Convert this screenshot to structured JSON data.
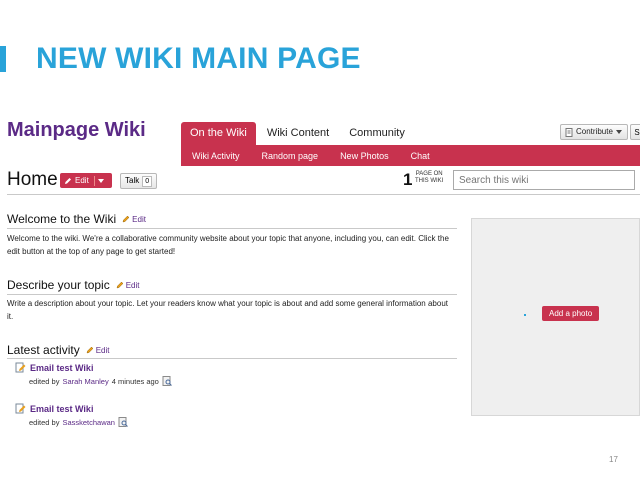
{
  "slide": {
    "title": "NEW WIKI MAIN PAGE",
    "number": "17",
    "accent_color": "#29a3d9"
  },
  "wiki": {
    "name": "Mainpage Wiki",
    "brand_color": "#5b2a86",
    "nav_color": "#c8324e",
    "tabs": [
      {
        "label": "On the Wiki",
        "active": true
      },
      {
        "label": "Wiki Content",
        "active": false
      },
      {
        "label": "Community",
        "active": false
      }
    ],
    "subnav": [
      "Wiki Activity",
      "Random page",
      "New Photos",
      "Chat"
    ],
    "contribute_label": "Contribute",
    "extra_button_label": "S",
    "page_title": "Home",
    "edit_label": "Edit",
    "talk_label": "Talk",
    "talk_count": "0",
    "page_count": "1",
    "page_count_label_line1": "PAGE ON",
    "page_count_label_line2": "THIS WIKI",
    "search_placeholder": "Search this wiki",
    "sections": {
      "welcome": {
        "heading": "Welcome to the Wiki",
        "edit": "Edit",
        "text": "Welcome to the wiki. We're a collaborative community website about your topic that anyone, including you, can edit. Click the edit button at the top of any page to get started!"
      },
      "describe": {
        "heading": "Describe your topic",
        "edit": "Edit",
        "text": "Write a description about your topic. Let your readers know what your topic is about and add some general information about it."
      },
      "activity": {
        "heading": "Latest activity",
        "edit": "Edit",
        "items": [
          {
            "title": "Email test Wiki",
            "prefix": "edited by",
            "user": "Sarah Manley",
            "time": "4 minutes ago"
          },
          {
            "title": "Email test Wiki",
            "prefix": "edited by",
            "user": "Sassketchawan",
            "time": ""
          }
        ]
      }
    },
    "add_photo_label": "Add a photo",
    "icons": {
      "page": "page-icon",
      "pencil": "pencil-icon",
      "diff": "diff-icon",
      "caret": "caret-down-icon"
    }
  }
}
